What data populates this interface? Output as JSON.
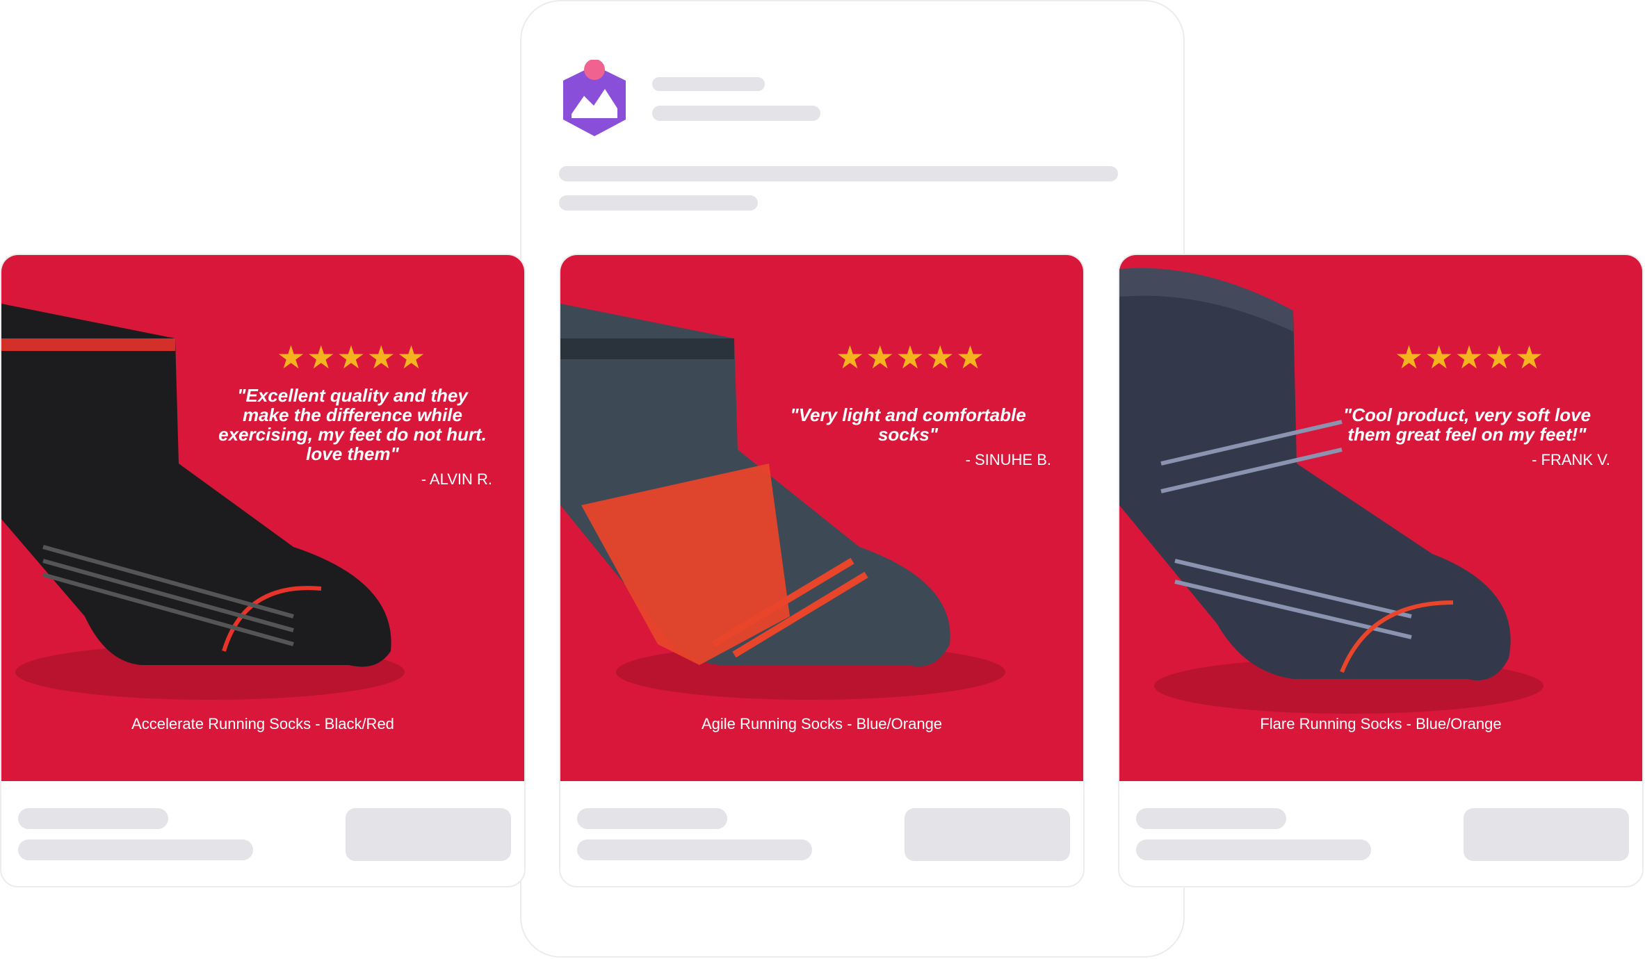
{
  "cards": [
    {
      "rating": "★★★★★",
      "quote": "\"Excellent quality and they make the difference while exercising, my feet do not hurt. love them\"",
      "author": "- ALVIN R.",
      "product": "Accelerate Running Socks - Black/Red",
      "sock_color": "#1c1c1e",
      "accent_color": "#e8332a"
    },
    {
      "rating": "★★★★★",
      "quote": "\"Very light and comfortable socks\"",
      "author": "- SINUHE B.",
      "product": "Agile Running Socks - Blue/Orange",
      "sock_color": "#3d4a55",
      "accent_color": "#e8452a"
    },
    {
      "rating": "★★★★★",
      "quote": "\"Cool product, very soft love them great feel on my feet!\"",
      "author": "- FRANK V.",
      "product": "Flare Running Socks - Blue/Orange",
      "sock_color": "#33384a",
      "accent_color": "#e8452a"
    }
  ],
  "colors": {
    "card_background": "#d9173a",
    "star": "#f5b320",
    "skeleton": "#e4e4e8",
    "logo": "#8a4fd8",
    "logo_dot": "#f0628f"
  }
}
